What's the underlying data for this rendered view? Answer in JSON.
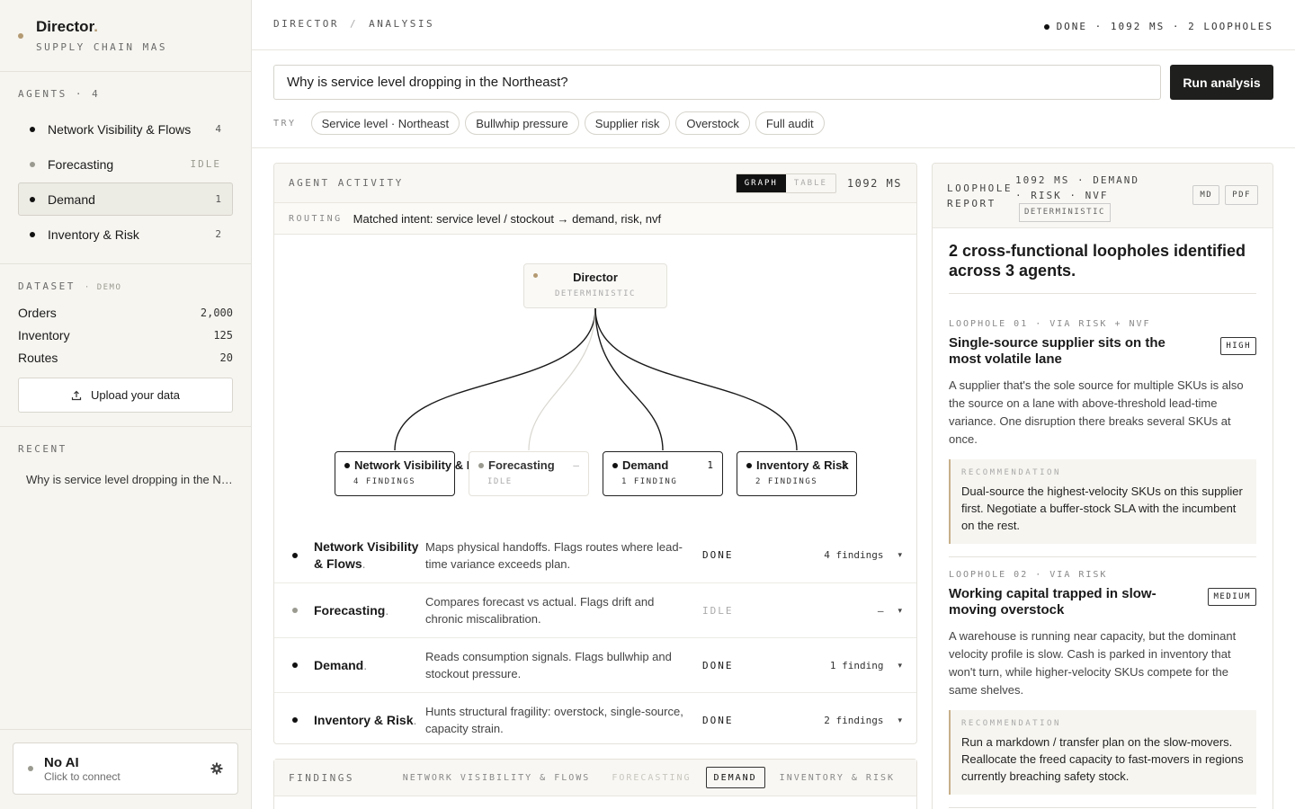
{
  "brand": {
    "title": "Director",
    "title_dot": ".",
    "subtitle": "SUPPLY CHAIN MAS"
  },
  "sidebar": {
    "agents_heading": "AGENTS · 4",
    "agents": [
      {
        "label": "Network Visibility & Flows",
        "count": "4",
        "state": "done"
      },
      {
        "label": "Forecasting",
        "count": "IDLE",
        "state": "idle"
      },
      {
        "label": "Demand",
        "count": "1",
        "state": "done"
      },
      {
        "label": "Inventory & Risk",
        "count": "2",
        "state": "done"
      }
    ],
    "dataset_heading": "DATASET",
    "dataset_tag": "· DEMO",
    "dataset": [
      {
        "label": "Orders",
        "value": "2,000"
      },
      {
        "label": "Inventory",
        "value": "125"
      },
      {
        "label": "Routes",
        "value": "20"
      }
    ],
    "upload_label": "Upload your data",
    "recent_heading": "RECENT",
    "recent": [
      "Why is service level dropping in the Northeast?"
    ],
    "ai": {
      "title": "No AI",
      "subtitle": "Click to connect"
    }
  },
  "topbar": {
    "crumb_1": "DIRECTOR",
    "crumb_sep": "/",
    "crumb_2": "ANALYSIS",
    "status": "DONE · 1092 MS · 2 LOOPHOLES"
  },
  "query": {
    "value": "Why is service level dropping in the Northeast?",
    "run_label": "Run analysis",
    "try_label": "TRY",
    "chips": [
      "Service level · Northeast",
      "Bullwhip pressure",
      "Supplier risk",
      "Overstock",
      "Full audit"
    ]
  },
  "activity": {
    "title": "AGENT ACTIVITY",
    "toggle_graph": "GRAPH",
    "toggle_table": "TABLE",
    "ms": "1092 MS",
    "routing_label": "ROUTING",
    "routing_text": "Matched intent: service level / stockout → demand, risk, nvf",
    "graph": {
      "director": {
        "title": "Director",
        "sub": "DETERMINISTIC"
      },
      "nodes": [
        {
          "title": "Network Visibility & Flows",
          "count": "",
          "sub": "4 FINDINGS"
        },
        {
          "title": "Forecasting",
          "count": "–",
          "sub": "IDLE"
        },
        {
          "title": "Demand",
          "count": "1",
          "sub": "1 FINDING"
        },
        {
          "title": "Inventory & Risk",
          "count": "2",
          "sub": "2 FINDINGS"
        }
      ]
    },
    "rows": [
      {
        "name": "Network Visibility & Flows",
        "desc": "Maps physical handoffs. Flags routes where lead-time variance exceeds plan.",
        "status": "DONE",
        "findings": "4 findings"
      },
      {
        "name": "Forecasting",
        "desc": "Compares forecast vs actual. Flags drift and chronic miscalibration.",
        "status": "IDLE",
        "findings": "—"
      },
      {
        "name": "Demand",
        "desc": "Reads consumption signals. Flags bullwhip and stockout pressure.",
        "status": "DONE",
        "findings": "1 finding"
      },
      {
        "name": "Inventory & Risk",
        "desc": "Hunts structural fragility: overstock, single-source, capacity strain.",
        "status": "DONE",
        "findings": "2 findings"
      }
    ],
    "name_dot": ".",
    "chevron": "▾"
  },
  "findings": {
    "title": "FINDINGS",
    "tabs": [
      "NETWORK VISIBILITY & FLOWS",
      "FORECASTING",
      "DEMAND",
      "INVENTORY & RISK"
    ]
  },
  "report": {
    "label": "LOOPHOLE REPORT",
    "meta": "1092 MS · DEMAND · RISK · NVF",
    "det": "DETERMINISTIC",
    "btn_md": "MD",
    "btn_pdf": "PDF",
    "summary": "2 cross-functional loopholes identified across 3 agents.",
    "rec_label": "RECOMMENDATION",
    "loopholes": [
      {
        "tag": "LOOPHOLE 01 · VIA RISK + NVF",
        "title": "Single-source supplier sits on the most volatile lane",
        "severity": "HIGH",
        "desc": "A supplier that's the sole source for multiple SKUs is also the source on a lane with above-threshold lead-time variance. One disruption there breaks several SKUs at once.",
        "recommendation": "Dual-source the highest-velocity SKUs on this supplier first. Negotiate a buffer-stock SLA with the incumbent on the rest."
      },
      {
        "tag": "LOOPHOLE 02 · VIA RISK",
        "title": "Working capital trapped in slow-moving overstock",
        "severity": "MEDIUM",
        "desc": "A warehouse is running near capacity, but the dominant velocity profile is slow. Cash is parked in inventory that won't turn, while higher-velocity SKUs compete for the same shelves.",
        "recommendation": "Run a markdown / transfer plan on the slow-movers. Reallocate the freed capacity to fast-movers in regions currently breaching safety stock."
      }
    ]
  }
}
